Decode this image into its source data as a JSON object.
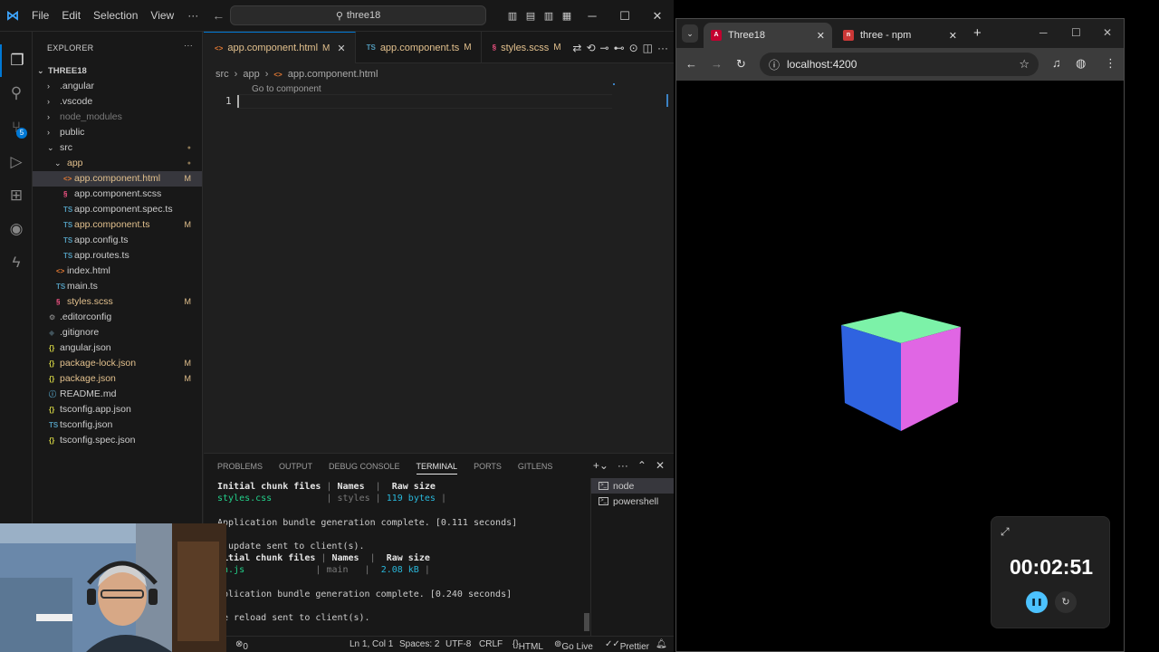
{
  "colors": {
    "accent": "#0078d4",
    "modified": "#e2c08d",
    "cube_top": "#7cf2a8",
    "cube_left": "#2f63e0",
    "cube_right": "#e066e4",
    "timer_pause": "#4cc2ff"
  },
  "vscode": {
    "menu": [
      "File",
      "Edit",
      "Selection",
      "View"
    ],
    "search_text": "three18",
    "explorer_title": "EXPLORER",
    "project_root": "THREE18",
    "tree": [
      {
        "label": ".angular",
        "kind": "folder",
        "depth": 1,
        "chev": "›",
        "status": ""
      },
      {
        "label": ".vscode",
        "kind": "folder",
        "depth": 1,
        "chev": "›",
        "status": ""
      },
      {
        "label": "node_modules",
        "kind": "folder-ignored",
        "depth": 1,
        "chev": "›",
        "status": ""
      },
      {
        "label": "public",
        "kind": "folder",
        "depth": 1,
        "chev": "›",
        "status": ""
      },
      {
        "label": "src",
        "kind": "folder",
        "depth": 1,
        "chev": "⌄",
        "status": "dot"
      },
      {
        "label": "app",
        "kind": "folder-mod",
        "depth": 2,
        "chev": "⌄",
        "status": "dot"
      },
      {
        "label": "app.component.html",
        "kind": "html",
        "depth": 3,
        "status": "M",
        "selected": true
      },
      {
        "label": "app.component.scss",
        "kind": "scss",
        "depth": 3,
        "status": ""
      },
      {
        "label": "app.component.spec.ts",
        "kind": "ts",
        "depth": 3,
        "status": ""
      },
      {
        "label": "app.component.ts",
        "kind": "ts",
        "depth": 3,
        "status": "M"
      },
      {
        "label": "app.config.ts",
        "kind": "ts",
        "depth": 3,
        "status": ""
      },
      {
        "label": "app.routes.ts",
        "kind": "ts",
        "depth": 3,
        "status": ""
      },
      {
        "label": "index.html",
        "kind": "html",
        "depth": 2,
        "status": ""
      },
      {
        "label": "main.ts",
        "kind": "ts",
        "depth": 2,
        "status": ""
      },
      {
        "label": "styles.scss",
        "kind": "scss",
        "depth": 2,
        "status": "M"
      },
      {
        "label": ".editorconfig",
        "kind": "gear",
        "depth": 1,
        "status": ""
      },
      {
        "label": ".gitignore",
        "kind": "git",
        "depth": 1,
        "status": ""
      },
      {
        "label": "angular.json",
        "kind": "json",
        "depth": 1,
        "status": ""
      },
      {
        "label": "package-lock.json",
        "kind": "json",
        "depth": 1,
        "status": "M"
      },
      {
        "label": "package.json",
        "kind": "json",
        "depth": 1,
        "status": "M"
      },
      {
        "label": "README.md",
        "kind": "info",
        "depth": 1,
        "status": ""
      },
      {
        "label": "tsconfig.app.json",
        "kind": "json",
        "depth": 1,
        "status": ""
      },
      {
        "label": "tsconfig.json",
        "kind": "tsjson",
        "depth": 1,
        "status": ""
      },
      {
        "label": "tsconfig.spec.json",
        "kind": "json",
        "depth": 1,
        "status": ""
      }
    ],
    "tabs": [
      {
        "label": "app.component.html",
        "icon": "<>",
        "status": "M",
        "active": true
      },
      {
        "label": "app.component.ts",
        "icon": "TS",
        "status": "M"
      },
      {
        "label": "styles.scss",
        "icon": "§",
        "status": "M"
      }
    ],
    "breadcrumb": [
      "src",
      "app",
      "app.component.html"
    ],
    "goto_hint": "Go to component",
    "line_number": "1",
    "panel_tabs": [
      "PROBLEMS",
      "OUTPUT",
      "DEBUG CONSOLE",
      "TERMINAL",
      "PORTS",
      "GITLENS"
    ],
    "terminal_sessions": [
      "node",
      "powershell"
    ],
    "terminal": {
      "l1_a": "Initial chunk files",
      "l1_b": "Names",
      "l1_c": "Raw size",
      "l2_a": "styles.css",
      "l2_b": "styles",
      "l2_c": "119 bytes",
      "l3": "Application bundle generation complete. [0.111 seconds]",
      "l4": "R update sent to client(s).",
      "l5_a": "nitial chunk files",
      "l5_b": "Names",
      "l5_c": "Raw size",
      "l6_a": "in.js",
      "l6_b": "main",
      "l6_c": "2.08 kB",
      "l7": "pplication bundle generation complete. [0.240 seconds]",
      "l8": "ge reload sent to client(s)."
    },
    "status": {
      "errors": "0",
      "position": "Ln 1, Col 1",
      "spaces": "Spaces: 2",
      "encoding": "UTF-8",
      "eol": "CRLF",
      "lang": "HTML",
      "golive": "Go Live",
      "prettier": "Prettier"
    }
  },
  "chrome": {
    "tabs": [
      {
        "title": "Three18",
        "active": true
      },
      {
        "title": "three - npm",
        "active": false
      }
    ],
    "url": "localhost:4200"
  },
  "timer": {
    "time": "00:02:51"
  }
}
